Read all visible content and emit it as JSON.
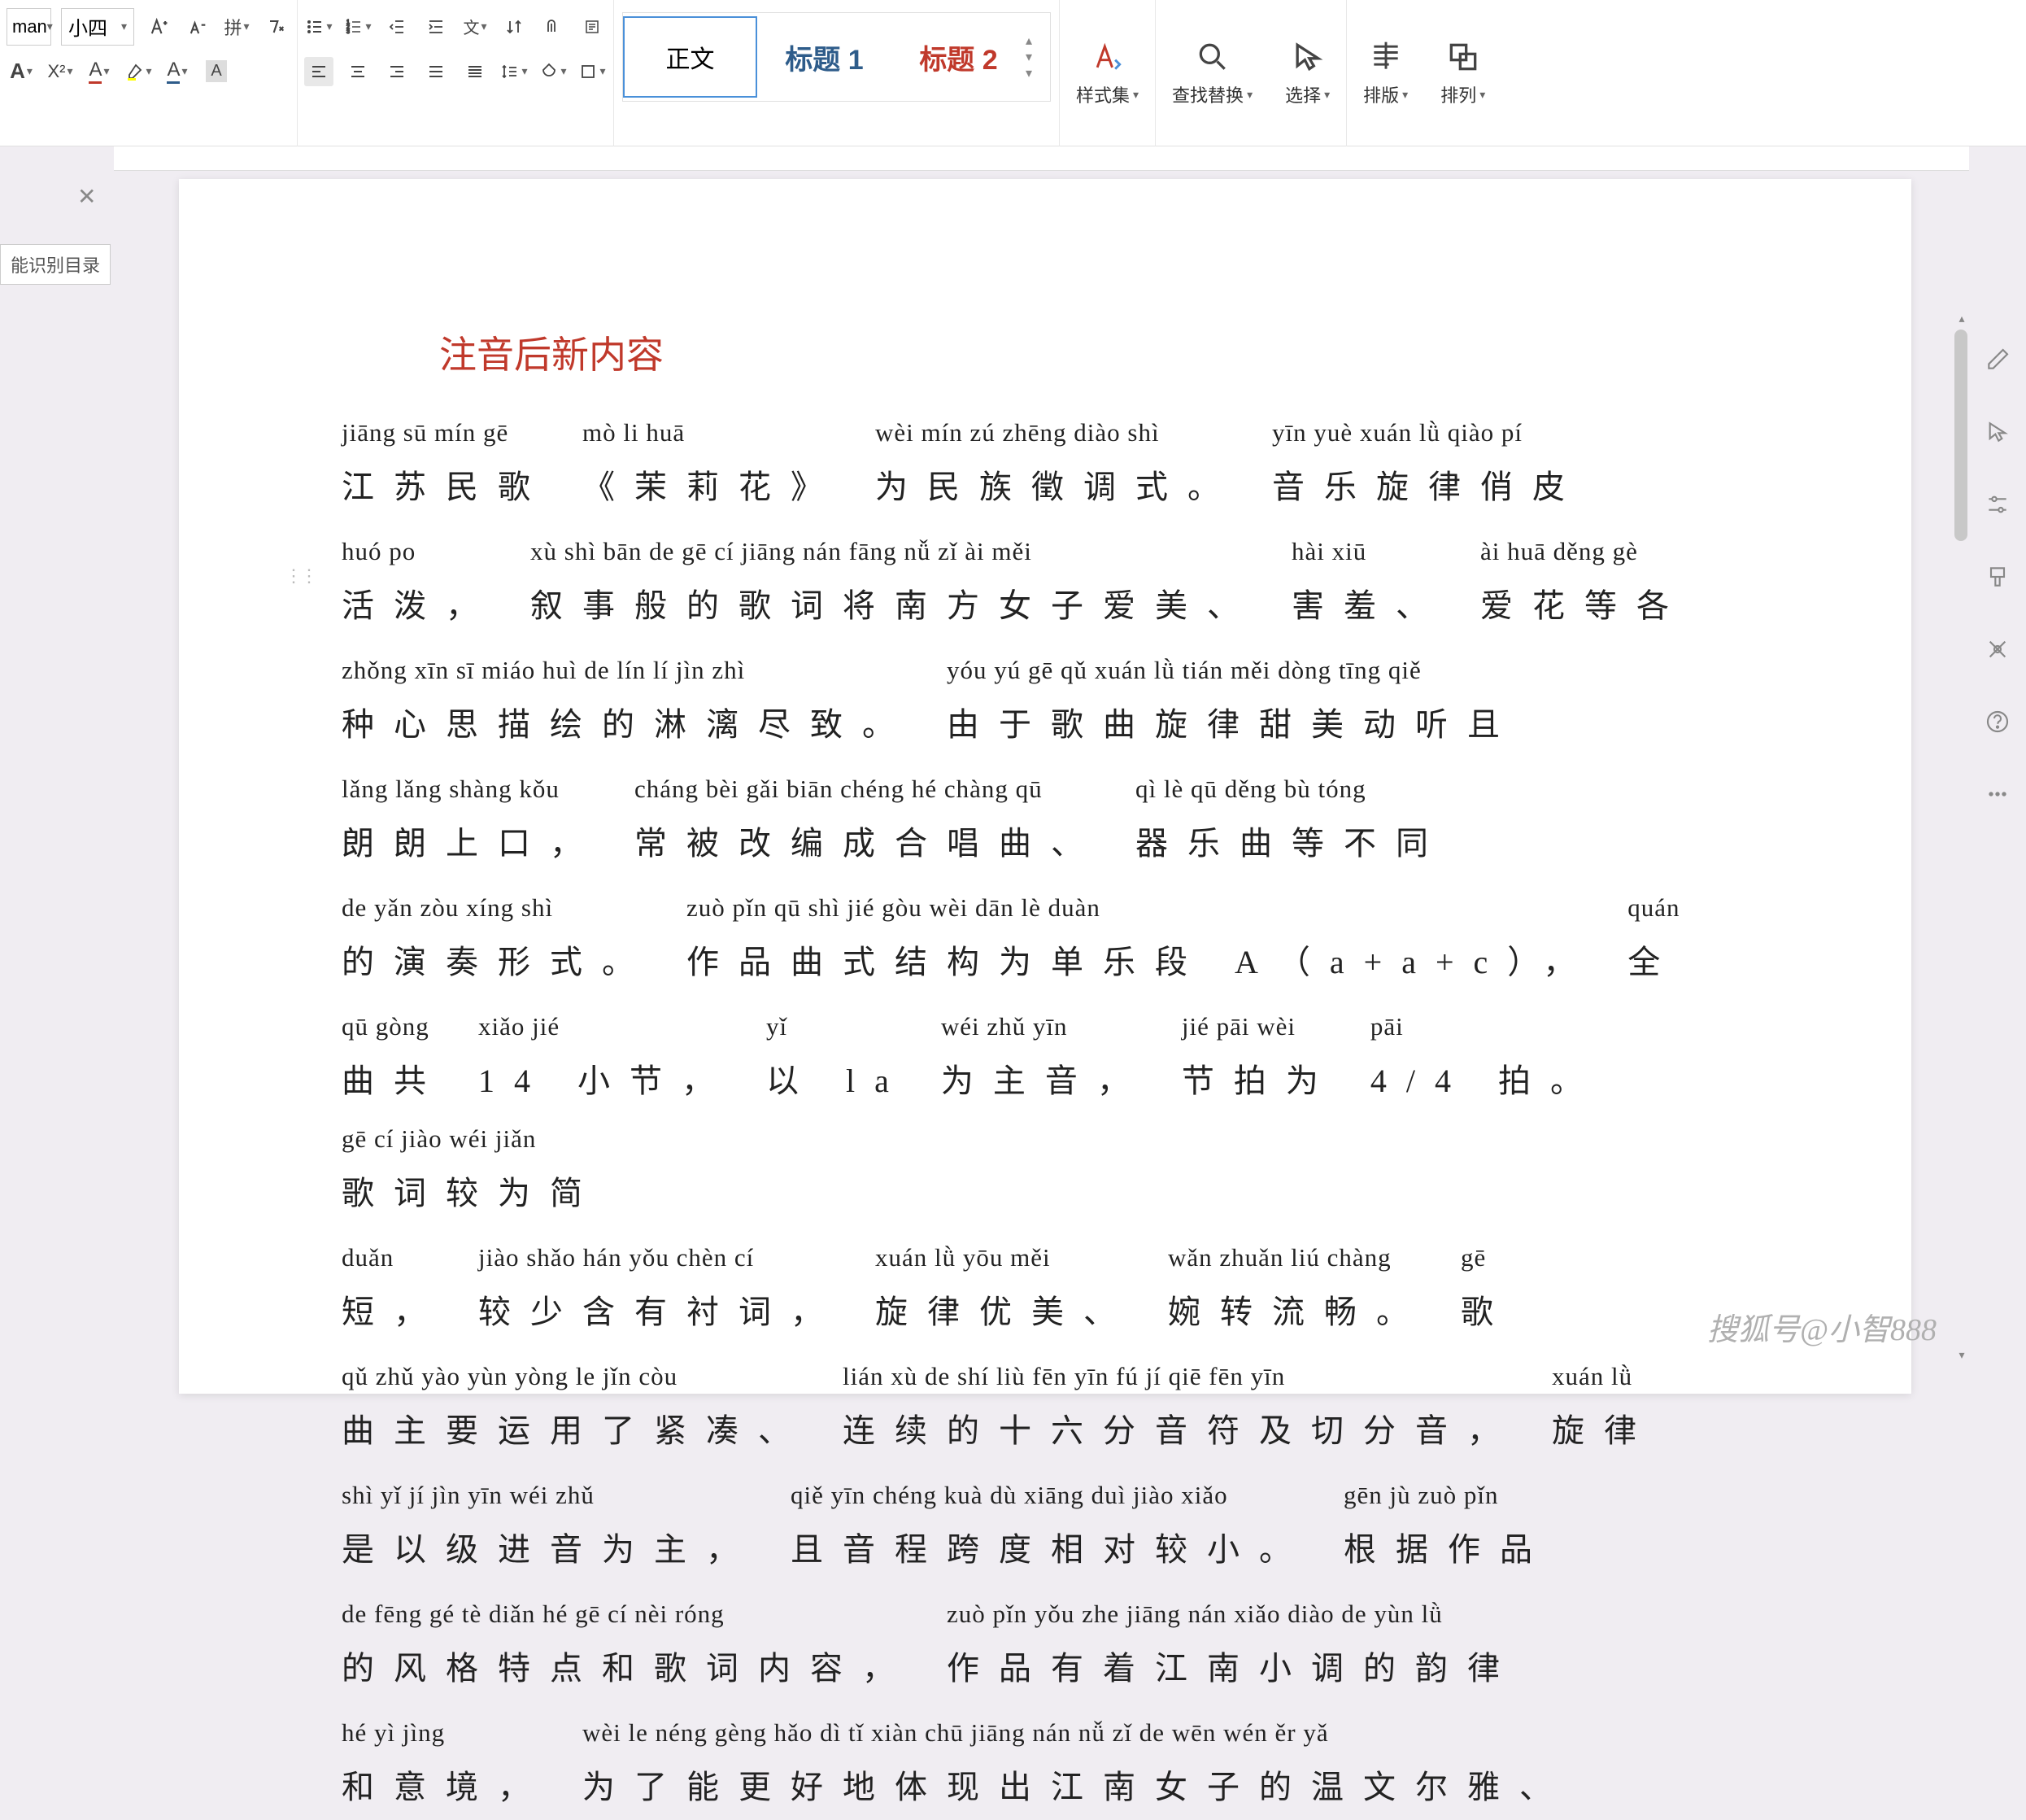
{
  "font": {
    "name": "man",
    "size": "小四"
  },
  "styles": {
    "normal": "正文",
    "heading1": "标题 1",
    "heading2": "标题 2",
    "gallery_label": "样式集"
  },
  "editing": {
    "find_replace": "查找替换",
    "select": "选择",
    "layout": "排版",
    "arrange": "排列"
  },
  "sidebar": {
    "toc_button": "能识别目录"
  },
  "document": {
    "heading": "注音后新内容",
    "lines": [
      {
        "groups": [
          {
            "pinyin": "jiāng sū mín gē",
            "hanzi": "江苏民歌"
          },
          {
            "pinyin": "mò li huā",
            "hanzi": "《茉莉花》"
          },
          {
            "pinyin": "wèi mín zú zhēng diào shì",
            "hanzi": "为民族徵调式。"
          },
          {
            "pinyin": "yīn yuè xuán lǜ qiào pí",
            "hanzi": "音乐旋律俏皮"
          }
        ]
      },
      {
        "groups": [
          {
            "pinyin": "huó po",
            "hanzi": "活泼，"
          },
          {
            "pinyin": "xù shì bān de gē cí jiāng nán fāng nǚ zǐ ài měi",
            "hanzi": "叙事般的歌词将南方女子爱美、"
          },
          {
            "pinyin": "hài xiū",
            "hanzi": "害羞、"
          },
          {
            "pinyin": "ài huā děng gè",
            "hanzi": "爱花等各"
          }
        ]
      },
      {
        "groups": [
          {
            "pinyin": "zhǒng xīn sī miáo huì de lín lí jìn zhì",
            "hanzi": "种心思描绘的淋漓尽致。"
          },
          {
            "pinyin": "yóu yú gē qǔ xuán lǜ tián měi dòng tīng qiě",
            "hanzi": "由于歌曲旋律甜美动听且"
          }
        ]
      },
      {
        "groups": [
          {
            "pinyin": "lǎng lǎng shàng kǒu",
            "hanzi": "朗朗上口，"
          },
          {
            "pinyin": "cháng bèi gǎi biān chéng hé chàng qū",
            "hanzi": "常被改编成合唱曲、"
          },
          {
            "pinyin": "qì lè qū děng bù tóng",
            "hanzi": "器乐曲等不同"
          }
        ]
      },
      {
        "groups": [
          {
            "pinyin": "de yǎn zòu xíng shì",
            "hanzi": "的演奏形式。"
          },
          {
            "pinyin": "zuò pǐn qū shì jié gòu wèi dān lè duàn",
            "hanzi": "作品曲式结构为单乐段 A（a+a+c），"
          },
          {
            "pinyin": "quán",
            "hanzi": "全"
          }
        ]
      },
      {
        "groups": [
          {
            "pinyin": "qū gòng",
            "hanzi": "曲共"
          },
          {
            "pinyin": "xiǎo jié",
            "hanzi": "14 小节，"
          },
          {
            "pinyin": "yǐ",
            "hanzi": "以 la"
          },
          {
            "pinyin": "wéi zhǔ yīn",
            "hanzi": "为主音，"
          },
          {
            "pinyin": "jié pāi wèi",
            "hanzi": "节拍为"
          },
          {
            "pinyin": "pāi",
            "hanzi": "4/4 拍。"
          },
          {
            "pinyin": "gē cí jiào wéi jiǎn",
            "hanzi": "歌词较为简"
          }
        ]
      },
      {
        "groups": [
          {
            "pinyin": "duǎn",
            "hanzi": "短，"
          },
          {
            "pinyin": "jiào shǎo hán yǒu chèn cí",
            "hanzi": "较少含有衬词，"
          },
          {
            "pinyin": "xuán lǜ yōu měi",
            "hanzi": "旋律优美、"
          },
          {
            "pinyin": "wǎn zhuǎn liú chàng",
            "hanzi": "婉转流畅。"
          },
          {
            "pinyin": "gē",
            "hanzi": "歌"
          }
        ]
      },
      {
        "groups": [
          {
            "pinyin": "qǔ zhǔ yào yùn yòng le jǐn còu",
            "hanzi": "曲主要运用了紧凑、"
          },
          {
            "pinyin": "lián xù de shí liù fēn yīn fú jí qiē fēn yīn",
            "hanzi": "连续的十六分音符及切分音，"
          },
          {
            "pinyin": "xuán lǜ",
            "hanzi": "旋律"
          }
        ]
      },
      {
        "groups": [
          {
            "pinyin": "shì yǐ jí jìn yīn wéi zhǔ",
            "hanzi": "是以级进音为主，"
          },
          {
            "pinyin": "qiě yīn chéng kuà dù xiāng duì jiào xiǎo",
            "hanzi": "且音程跨度相对较小。"
          },
          {
            "pinyin": "gēn jù zuò pǐn",
            "hanzi": "根据作品"
          }
        ]
      },
      {
        "groups": [
          {
            "pinyin": "de fēng gé tè diǎn hé gē cí nèi róng",
            "hanzi": "的风格特点和歌词内容，"
          },
          {
            "pinyin": "zuò pǐn yǒu zhe jiāng nán xiǎo diào de yùn lǜ",
            "hanzi": "作品有着江南小调的韵律"
          }
        ]
      },
      {
        "groups": [
          {
            "pinyin": "hé yì jìng",
            "hanzi": "和意境，"
          },
          {
            "pinyin": "wèi le néng gèng hǎo dì tǐ xiàn chū jiāng nán nǚ zǐ de wēn wén ěr yǎ",
            "hanzi": "为了能更好地体现出江南女子的温文尔雅、"
          }
        ]
      }
    ]
  },
  "watermark": "搜狐号@小智888"
}
